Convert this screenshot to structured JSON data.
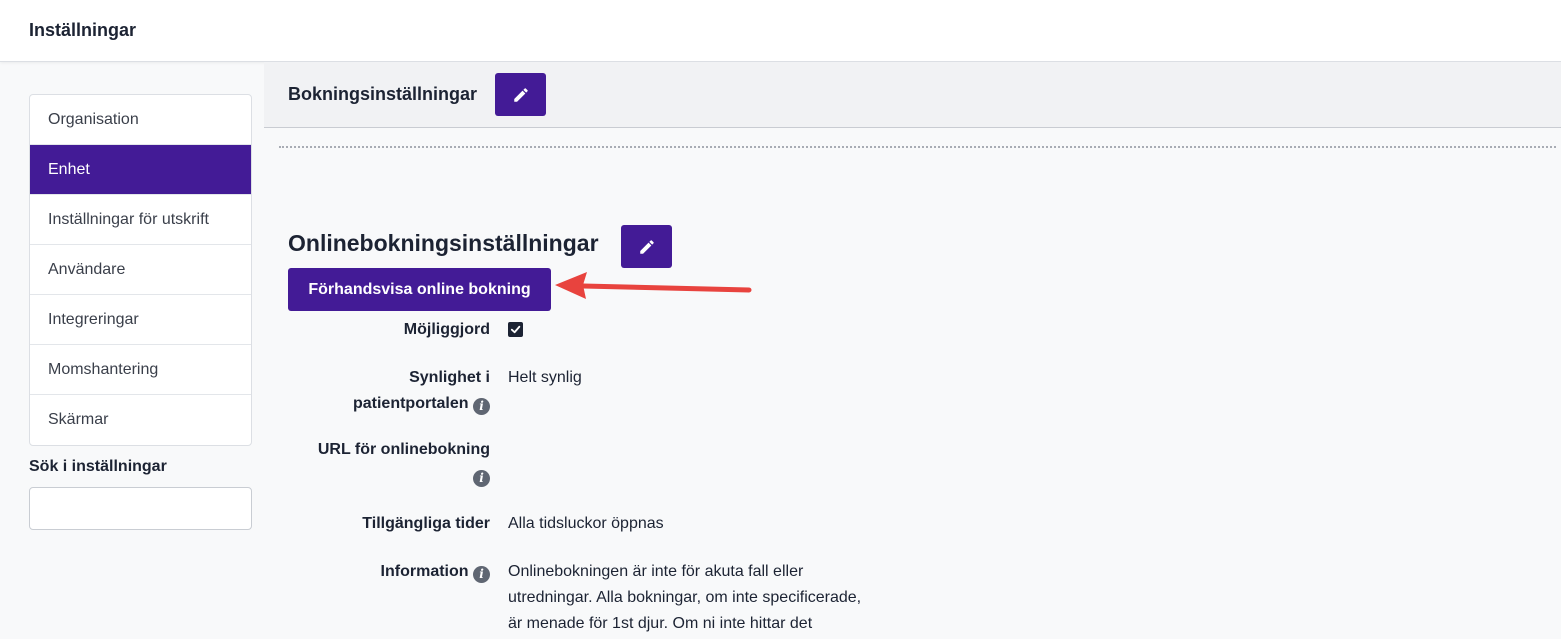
{
  "header": {
    "title": "Inställningar"
  },
  "sidebar": {
    "items": [
      {
        "label": "Organisation"
      },
      {
        "label": "Enhet"
      },
      {
        "label": "Inställningar för utskrift"
      },
      {
        "label": "Användare"
      },
      {
        "label": "Integreringar"
      },
      {
        "label": "Momshantering"
      },
      {
        "label": "Skärmar"
      }
    ],
    "active_item": "Enhet",
    "search_label": "Sök i inställningar",
    "search_value": ""
  },
  "booking_settings": {
    "title": "Bokningsinställningar"
  },
  "online_booking": {
    "title": "Onlinebokningsinställningar",
    "preview_button": "Förhandsvisa online bokning",
    "fields": {
      "enabled": {
        "label": "Möjliggjord",
        "checked": true
      },
      "visibility": {
        "label_line1": "Synlighet i",
        "label_line2": "patientportalen",
        "value": "Helt synlig"
      },
      "url": {
        "label": "URL för onlinebokning",
        "value": ""
      },
      "available_times": {
        "label": "Tillgängliga tider",
        "value": "Alla tidsluckor öppnas"
      },
      "information": {
        "label": "Information",
        "value_line1": "Onlinebokningen är inte för akuta fall eller",
        "value_line2": "utredningar. Alla bokningar, om inte specificerade,",
        "value_line3": "är menade för 1st djur. Om ni inte hittar det"
      }
    }
  },
  "colors": {
    "accent": "#431b96",
    "annotation_arrow": "#e8433e"
  },
  "icons": [
    "pencil-icon",
    "info-icon",
    "checkmark-icon"
  ]
}
